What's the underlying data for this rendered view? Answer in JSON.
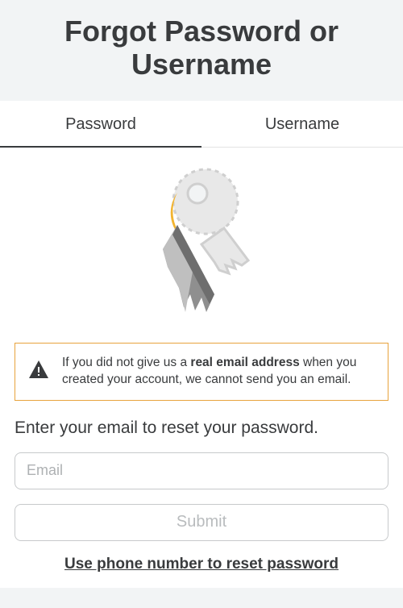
{
  "header": {
    "title": "Forgot Password or Username"
  },
  "tabs": {
    "password": "Password",
    "username": "Username"
  },
  "alert": {
    "prefix": "If you did not give us a ",
    "bold": "real email address",
    "suffix": " when you created your account, we cannot send you an email."
  },
  "form": {
    "instruction": "Enter your email to reset your password.",
    "email_placeholder": "Email",
    "submit_label": "Submit",
    "alt_link": "Use phone number to reset password"
  }
}
